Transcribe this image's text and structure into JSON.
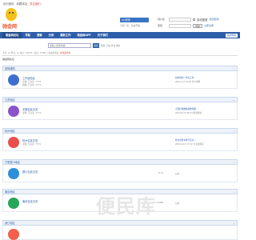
{
  "topbar": {
    "links": [
      "设为首页",
      "收藏本站"
    ],
    "highlight": "关注我们"
  },
  "logo": {
    "text": "驰金网"
  },
  "qq": {
    "button": "QQ登录",
    "hint": "只需一步，快速开始"
  },
  "login": {
    "user_label": "用户名",
    "user_placeholder": "",
    "pass_label": "密码",
    "pass_placeholder": "",
    "remember": "自动登录",
    "forgot": "找回密码",
    "login_btn": "登录",
    "register": "立即注册"
  },
  "nav": {
    "items": [
      "驰金网论坛",
      "导航",
      "搜索",
      "分类",
      "最新工作",
      "驰金网APP",
      "关于我们"
    ],
    "right": "快捷导航"
  },
  "search": {
    "placeholder": "请输入搜索内容",
    "button": "搜索",
    "hot": "热搜: 活动 交流 求助"
  },
  "stats": {
    "text": "今日: 0 | 昨日: 0 | 帖子: 33937 | 会员: 27094 | 欢迎新会员:",
    "new_member": "佳佳爱吃鱼"
  },
  "crumb": {
    "text": "驰金网论坛"
  },
  "sections": [
    {
      "title": "官网通知",
      "forum": {
        "title": "工作经验区",
        "sub1": "主题: 已关注: 7774",
        "sub2": "帖数: 已关注: 7774",
        "count": "",
        "last_title": "如何找到一份好工作",
        "last_time": "2023-7-2 10:26 佳人难再"
      }
    },
    {
      "title": "江苏地区",
      "forum": {
        "title": "无锡信息交流",
        "sub1": "主题: 已关注: 7774",
        "sub2": "",
        "count": "",
        "last_title": "无锡社保缴纳基数调整...",
        "last_time": "2023-8-14 08:33 盼望暖春"
      }
    },
    {
      "title": "杭州地区",
      "forum": {
        "title": "杭州信息交流",
        "sub1": "主题: 已关注: 7774",
        "sub2": "",
        "count": "",
        "last_title": "杭州市区车牌号竞价...",
        "last_time": "2023-10-3 17:12 公主爱喝茶"
      }
    },
    {
      "title": "宁夏银川地区",
      "forum": {
        "title": "银川信息交流",
        "sub1": "",
        "sub2": "",
        "count": "0 / 0",
        "last_title": "从未",
        "last_time": ""
      }
    },
    {
      "title": "南京地区",
      "forum": {
        "title": "南京信息交流",
        "sub1": "",
        "sub2": "",
        "count": "47 / 1,000",
        "last_title": "从未",
        "last_time": ""
      }
    },
    {
      "title": "浙江地区",
      "forum": {
        "title": "",
        "sub1": "",
        "sub2": "",
        "count": "",
        "last_title": "",
        "last_time": ""
      }
    }
  ],
  "watermark": {
    "text": "便民库"
  },
  "colors": {
    "nav": "#2e5ea8",
    "accent": "#f6c21a",
    "link": "#2e5ea8"
  }
}
